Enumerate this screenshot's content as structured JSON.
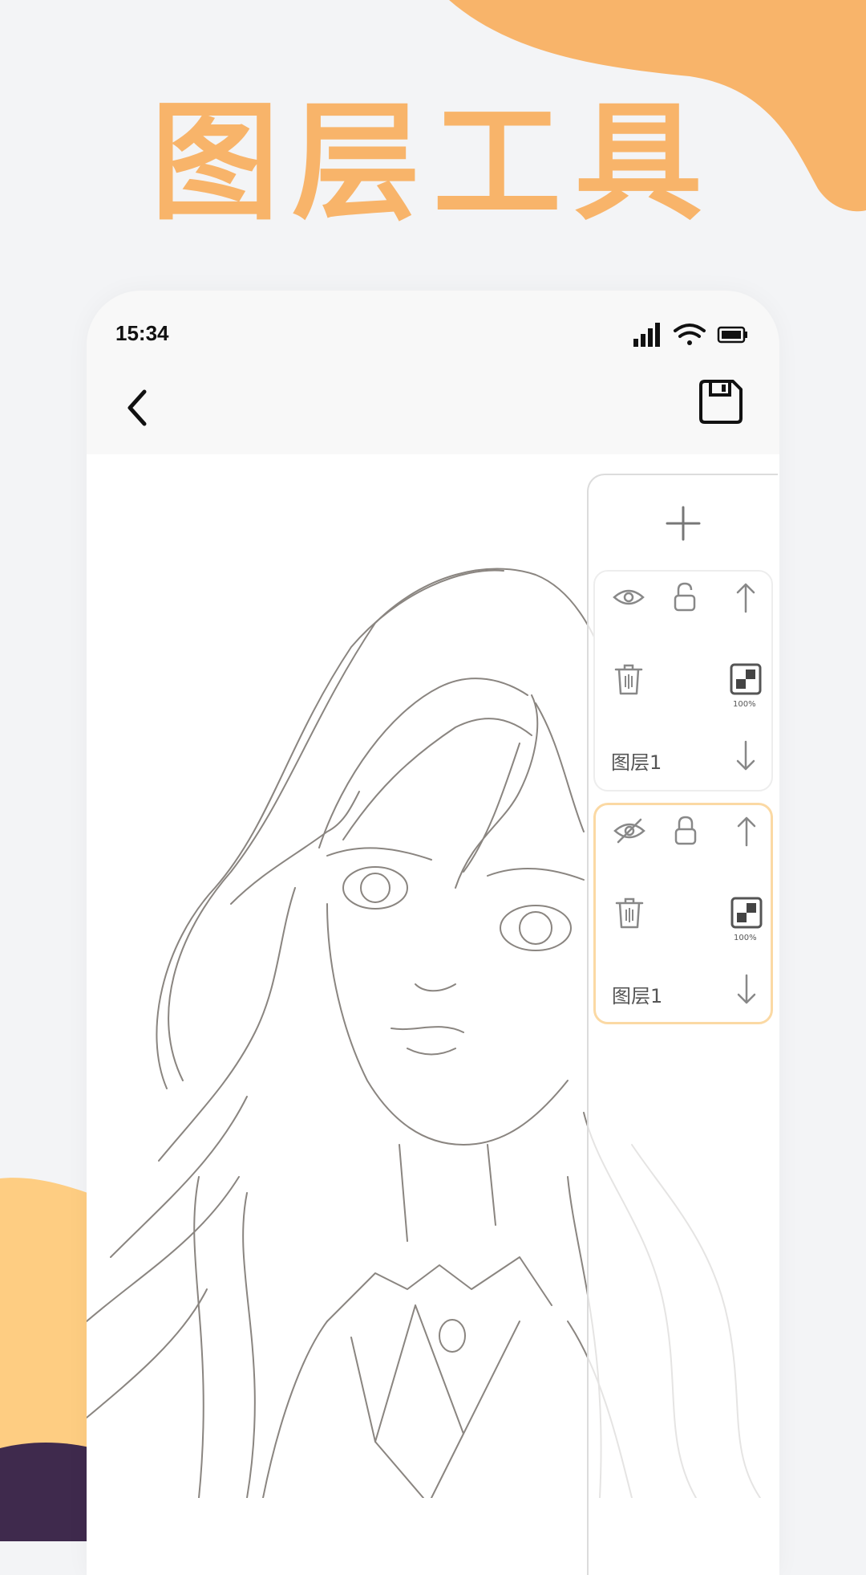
{
  "headline": "图层工具",
  "colors": {
    "accent_orange": "#f8b46a",
    "accent_yellow": "#fecd82",
    "accent_purple": "#3f2a4d",
    "selected_border": "#fbd9a4"
  },
  "status_bar": {
    "time": "15:34",
    "icons": [
      "signal-icon",
      "wifi-icon",
      "battery-icon"
    ]
  },
  "nav_bar": {
    "back_icon": "chevron-left-icon",
    "save_icon": "floppy-disk-icon"
  },
  "layer_panel": {
    "add_icon": "plus-icon",
    "layers": [
      {
        "name": "图层1",
        "opacity_label": "100%",
        "visible": true,
        "locked": false,
        "selected": false
      },
      {
        "name": "图层1",
        "opacity_label": "100%",
        "visible": false,
        "locked": true,
        "selected": true
      }
    ]
  }
}
